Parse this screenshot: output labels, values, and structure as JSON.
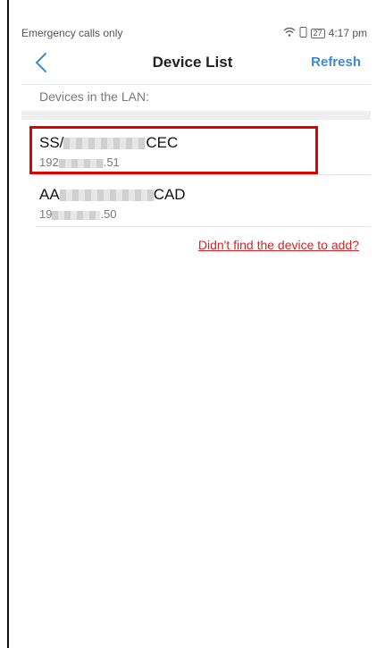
{
  "status_bar": {
    "carrier": "Emergency calls only",
    "battery": "27",
    "time": "4:17 pm",
    "icons": [
      "wifi-icon",
      "phone-icon",
      "battery-icon"
    ]
  },
  "nav": {
    "back_icon": "chevron-left-icon",
    "title": "Device List",
    "refresh_label": "Refresh"
  },
  "section": {
    "label": "Devices in the LAN:"
  },
  "devices": [
    {
      "name_start": "SS/",
      "name_end": "CEC",
      "ip_start": "192",
      "ip_end": ".51"
    },
    {
      "name_start": "AA",
      "name_end": "CAD",
      "ip_start": "19",
      "ip_end": ".50"
    }
  ],
  "footer": {
    "not_found_link": "Didn't find the device to add?"
  },
  "colors": {
    "accent": "#3a8ad6",
    "highlight": "#e10000",
    "link": "#d42626"
  }
}
